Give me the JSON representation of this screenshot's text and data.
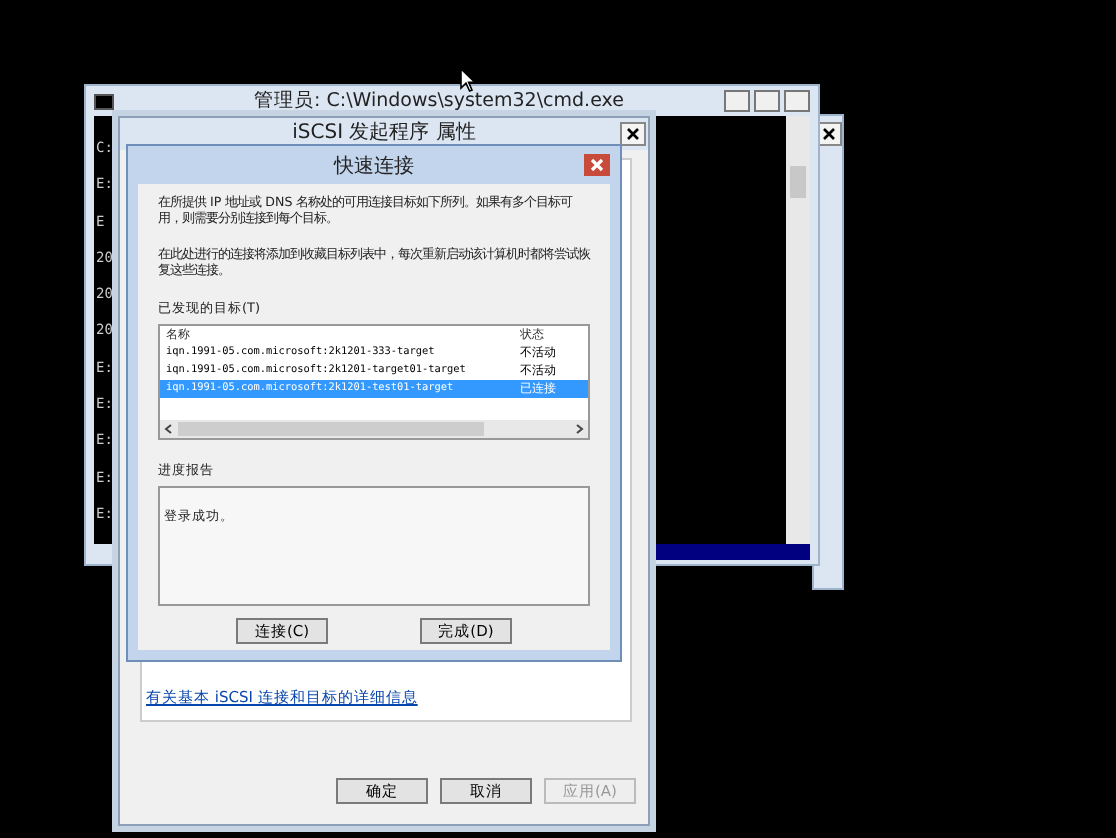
{
  "console_window": {
    "title": "管理员: C:\\Windows\\system32\\cmd.exe",
    "lines": [
      "C:",
      "E:",
      "E",
      "20",
      "20",
      "20",
      "E:",
      "E:",
      "E:",
      "E:",
      "E:"
    ]
  },
  "properties_dialog": {
    "title": "iSCSI 发起程序 属性",
    "link": "有关基本 iSCSI 连接和目标的详细信息",
    "buttons": [
      {
        "label": "确定",
        "disabled": false
      },
      {
        "label": "取消",
        "disabled": false
      },
      {
        "label": "应用(A)",
        "disabled": true
      }
    ]
  },
  "quick_connect": {
    "title": "快速连接",
    "paragraphs": [
      "在所提供 IP 地址或 DNS 名称处的可用连接目标如下所列。如果有多个目标可用，则需要分别连接到每个目标。",
      "在此处进行的连接将添加到收藏目标列表中，每次重新启动该计算机时都将尝试恢复这些连接。"
    ],
    "targets_label": "已发现的目标(T)",
    "columns": [
      "名称",
      "状态"
    ],
    "rows": [
      {
        "name": "iqn.1991-05.com.microsoft:2k1201-333-target",
        "status": "不活动",
        "selected": false
      },
      {
        "name": "iqn.1991-05.com.microsoft:2k1201-target01-target",
        "status": "不活动",
        "selected": false
      },
      {
        "name": "iqn.1991-05.com.microsoft:2k1201-test01-target",
        "status": "已连接",
        "selected": true
      }
    ],
    "progress_label": "进度报告",
    "progress_text": "登录成功。",
    "buttons": [
      {
        "label": "连接(C)",
        "disabled": false
      },
      {
        "label": "完成(D)",
        "disabled": false
      }
    ]
  }
}
